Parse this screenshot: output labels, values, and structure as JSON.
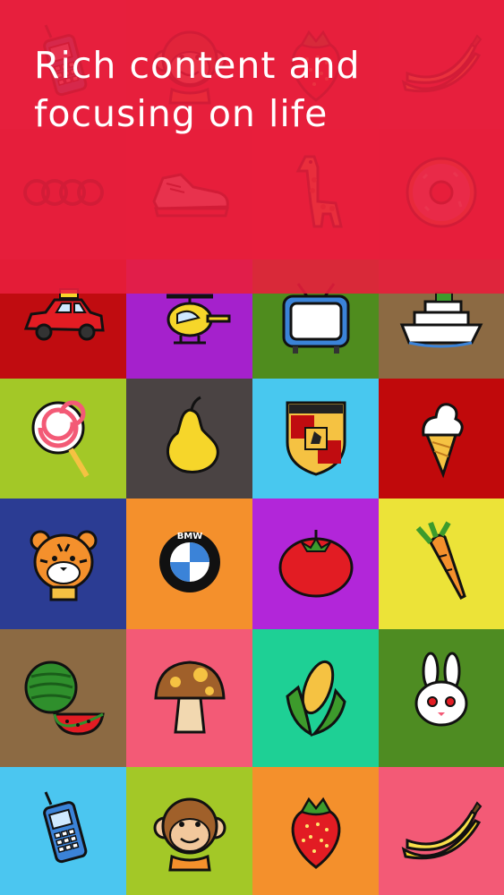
{
  "headline": {
    "line1": "Rich content and",
    "line2": "focusing on life"
  },
  "tiles": [
    {
      "icon": "cellphone-icon",
      "bg": "#dc2947"
    },
    {
      "icon": "monkey-icon",
      "bg": "#df2a40"
    },
    {
      "icon": "strawberry-icon",
      "bg": "#e0283c"
    },
    {
      "icon": "banana-icon",
      "bg": "#dd2947"
    },
    {
      "icon": "audi-logo-icon",
      "bg": "#d82538"
    },
    {
      "icon": "shoes-icon",
      "bg": "#dc2638"
    },
    {
      "icon": "giraffe-icon",
      "bg": "#e3243a"
    },
    {
      "icon": "donut-icon",
      "bg": "#d92337"
    },
    {
      "icon": "taxi-icon",
      "bg": "#c00c10"
    },
    {
      "icon": "helicopter-icon",
      "bg": "#a521cc"
    },
    {
      "icon": "tv-icon",
      "bg": "#4f8c1e"
    },
    {
      "icon": "ship-icon",
      "bg": "#8c6a43"
    },
    {
      "icon": "lollipop-icon",
      "bg": "#a3c827"
    },
    {
      "icon": "pear-icon",
      "bg": "#4a4343"
    },
    {
      "icon": "porsche-logo-icon",
      "bg": "#48c8ef"
    },
    {
      "icon": "ice-cream-icon",
      "bg": "#c0090b"
    },
    {
      "icon": "tiger-icon",
      "bg": "#2b3c93"
    },
    {
      "icon": "bmw-logo-icon",
      "bg": "#f4902c"
    },
    {
      "icon": "tomato-icon",
      "bg": "#b226d9"
    },
    {
      "icon": "carrot-icon",
      "bg": "#ece338"
    },
    {
      "icon": "watermelon-icon",
      "bg": "#8c6a43"
    },
    {
      "icon": "mushroom-icon",
      "bg": "#f35a76"
    },
    {
      "icon": "corn-icon",
      "bg": "#1ed095"
    },
    {
      "icon": "rabbit-icon",
      "bg": "#4e8c22"
    },
    {
      "icon": "cellphone-icon",
      "bg": "#4bc6f0"
    },
    {
      "icon": "monkey-icon",
      "bg": "#a3c827"
    },
    {
      "icon": "strawberry-icon",
      "bg": "#f4902c"
    },
    {
      "icon": "banana-icon",
      "bg": "#f35a76"
    }
  ]
}
